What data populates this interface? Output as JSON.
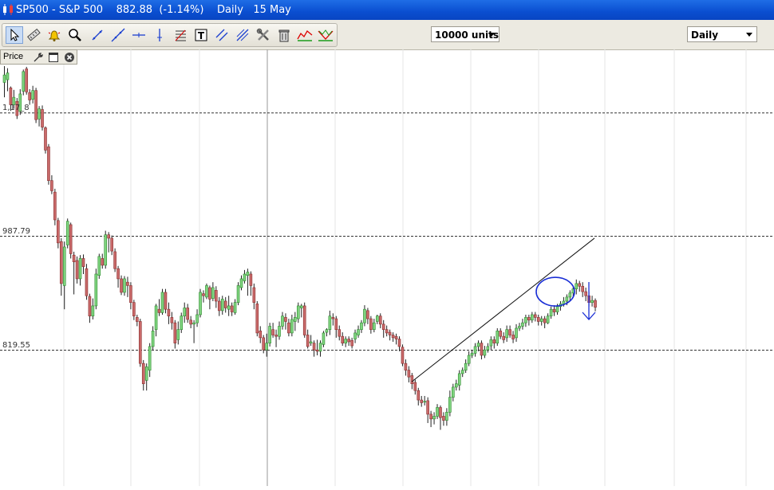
{
  "window": {
    "symbol": "SP500 - S&P 500",
    "price": "882.88",
    "change": "(-1.14%)",
    "timeframe": "Daily",
    "date": "15 May"
  },
  "toolbar": {
    "tools": [
      "pointer-tool",
      "ruler-tool",
      "alert-bell-tool",
      "zoom-tool",
      "trendline-tool",
      "ray-line-tool",
      "horizontal-line-tool",
      "vertical-line-tool",
      "fibonacci-tool",
      "text-tool",
      "parallel-channel-tool",
      "pitchfork-tool",
      "properties-tool",
      "delete-tool",
      "indicator-tool",
      "pattern-tool"
    ],
    "units_label": "10000 units",
    "period_label": "Daily"
  },
  "price_panel": {
    "tab_label": "Price"
  },
  "chart_data": {
    "type": "candlestick",
    "y_scale": {
      "top_value": 1252.0,
      "bottom_value": 619.0
    },
    "price_levels": [
      {
        "label": "1,17_8",
        "value": 1170.0
      },
      {
        "label": "987.79",
        "value": 987.79
      },
      {
        "label": "819.55",
        "value": 819.55
      }
    ],
    "annotation": {
      "trendline_from": 773,
      "trendline_to": 985,
      "circled_price": 906,
      "arrow": "down"
    },
    "candles": [
      [
        1215,
        1226,
        1193,
        1239
      ],
      [
        1219,
        1229,
        1202,
        1236
      ],
      [
        1207,
        1182,
        1173,
        1209
      ],
      [
        1182,
        1193,
        1176,
        1204
      ],
      [
        1187,
        1166,
        1161,
        1192
      ],
      [
        1172,
        1198,
        1167,
        1205
      ],
      [
        1202,
        1231,
        1196,
        1234
      ],
      [
        1235,
        1201,
        1197,
        1238
      ],
      [
        1200,
        1189,
        1182,
        1205
      ],
      [
        1190,
        1203,
        1184,
        1210
      ],
      [
        1203,
        1160,
        1155,
        1207
      ],
      [
        1161,
        1176,
        1150,
        1180
      ],
      [
        1175,
        1149,
        1144,
        1181
      ],
      [
        1148,
        1115,
        1110,
        1150
      ],
      [
        1120,
        1070,
        1064,
        1124
      ],
      [
        1070,
        1055,
        1050,
        1078
      ],
      [
        1053,
        1012,
        1004,
        1058
      ],
      [
        1011,
        978,
        970,
        1015
      ],
      [
        980,
        918,
        900,
        985
      ],
      [
        915,
        972,
        880,
        980
      ],
      [
        975,
        1010,
        970,
        1014
      ],
      [
        1005,
        962,
        955,
        1008
      ],
      [
        960,
        950,
        902,
        965
      ],
      [
        952,
        925,
        918,
        958
      ],
      [
        925,
        955,
        915,
        960
      ],
      [
        955,
        943,
        932,
        961
      ],
      [
        940,
        900,
        894,
        947
      ],
      [
        899,
        870,
        860,
        903
      ],
      [
        870,
        885,
        865,
        896
      ],
      [
        885,
        932,
        880,
        940
      ],
      [
        930,
        958,
        925,
        962
      ],
      [
        955,
        945,
        940,
        962
      ],
      [
        945,
        990,
        940,
        996
      ],
      [
        990,
        985,
        964,
        994
      ],
      [
        985,
        966,
        960,
        989
      ],
      [
        965,
        940,
        935,
        970
      ],
      [
        940,
        925,
        912,
        944
      ],
      [
        925,
        905,
        901,
        930
      ],
      [
        905,
        925,
        900,
        929
      ],
      [
        920,
        915,
        898,
        928
      ],
      [
        915,
        890,
        880,
        920
      ],
      [
        890,
        870,
        864,
        894
      ],
      [
        868,
        862,
        855,
        872
      ],
      [
        862,
        800,
        795,
        866
      ],
      [
        800,
        770,
        760,
        805
      ],
      [
        775,
        795,
        760,
        800
      ],
      [
        790,
        825,
        780,
        830
      ],
      [
        825,
        848,
        820,
        855
      ],
      [
        850,
        885,
        840,
        888
      ],
      [
        880,
        875,
        870,
        895
      ],
      [
        875,
        905,
        872,
        910
      ],
      [
        905,
        880,
        874,
        910
      ],
      [
        880,
        870,
        858,
        890
      ],
      [
        868,
        860,
        850,
        876
      ],
      [
        860,
        830,
        822,
        864
      ],
      [
        835,
        850,
        828,
        862
      ],
      [
        850,
        870,
        845,
        875
      ],
      [
        870,
        882,
        860,
        890
      ],
      [
        882,
        865,
        860,
        888
      ],
      [
        864,
        858,
        852,
        870
      ],
      [
        858,
        860,
        830,
        864
      ],
      [
        860,
        872,
        854,
        880
      ],
      [
        872,
        905,
        868,
        910
      ],
      [
        903,
        900,
        890,
        908
      ],
      [
        898,
        915,
        895,
        918
      ],
      [
        912,
        895,
        880,
        915
      ],
      [
        896,
        912,
        892,
        920
      ],
      [
        908,
        892,
        882,
        914
      ],
      [
        892,
        878,
        870,
        898
      ],
      [
        878,
        895,
        872,
        900
      ],
      [
        892,
        882,
        875,
        898
      ],
      [
        880,
        885,
        870,
        900
      ],
      [
        885,
        876,
        870,
        890
      ],
      [
        875,
        890,
        872,
        895
      ],
      [
        890,
        915,
        886,
        920
      ],
      [
        912,
        925,
        908,
        930
      ],
      [
        922,
        932,
        918,
        938
      ],
      [
        930,
        935,
        900,
        940
      ],
      [
        932,
        915,
        900,
        936
      ],
      [
        912,
        890,
        880,
        918
      ],
      [
        888,
        845,
        840,
        892
      ],
      [
        848,
        838,
        830,
        855
      ],
      [
        838,
        820,
        815,
        842
      ],
      [
        820,
        830,
        810,
        844
      ],
      [
        830,
        855,
        825,
        860
      ],
      [
        850,
        842,
        838,
        860
      ],
      [
        842,
        840,
        824,
        850
      ],
      [
        840,
        855,
        835,
        862
      ],
      [
        855,
        870,
        850,
        876
      ],
      [
        868,
        862,
        850,
        874
      ],
      [
        860,
        845,
        840,
        866
      ],
      [
        845,
        865,
        840,
        872
      ],
      [
        862,
        868,
        848,
        876
      ],
      [
        866,
        885,
        860,
        890
      ],
      [
        882,
        885,
        868,
        888
      ],
      [
        885,
        842,
        838,
        890
      ],
      [
        842,
        825,
        822,
        850
      ],
      [
        830,
        832,
        826,
        842
      ],
      [
        830,
        820,
        810,
        834
      ],
      [
        820,
        818,
        812,
        835
      ],
      [
        818,
        830,
        810,
        834
      ],
      [
        828,
        845,
        824,
        848
      ],
      [
        846,
        850,
        840,
        852
      ],
      [
        850,
        870,
        842,
        878
      ],
      [
        868,
        866,
        856,
        874
      ],
      [
        866,
        850,
        838,
        870
      ],
      [
        850,
        840,
        834,
        856
      ],
      [
        840,
        830,
        826,
        846
      ],
      [
        830,
        836,
        824,
        840
      ],
      [
        836,
        832,
        826,
        840
      ],
      [
        834,
        826,
        822,
        838
      ],
      [
        836,
        845,
        830,
        850
      ],
      [
        842,
        850,
        838,
        856
      ],
      [
        850,
        860,
        845,
        864
      ],
      [
        860,
        880,
        855,
        886
      ],
      [
        878,
        866,
        858,
        882
      ],
      [
        866,
        850,
        844,
        870
      ],
      [
        850,
        860,
        846,
        866
      ],
      [
        862,
        870,
        858,
        872
      ],
      [
        870,
        858,
        852,
        874
      ],
      [
        858,
        850,
        838,
        864
      ],
      [
        850,
        845,
        840,
        856
      ],
      [
        846,
        842,
        834,
        850
      ],
      [
        842,
        838,
        832,
        846
      ],
      [
        840,
        836,
        828,
        844
      ],
      [
        836,
        825,
        818,
        840
      ],
      [
        824,
        800,
        796,
        828
      ],
      [
        800,
        790,
        782,
        806
      ],
      [
        790,
        780,
        772,
        796
      ],
      [
        782,
        770,
        762,
        786
      ],
      [
        772,
        760,
        754,
        776
      ],
      [
        760,
        746,
        738,
        764
      ],
      [
        746,
        742,
        736,
        752
      ],
      [
        744,
        744,
        738,
        752
      ],
      [
        745,
        725,
        712,
        750
      ],
      [
        725,
        718,
        706,
        730
      ],
      [
        718,
        722,
        710,
        728
      ],
      [
        722,
        735,
        718,
        740
      ],
      [
        735,
        720,
        702,
        738
      ],
      [
        722,
        716,
        708,
        728
      ],
      [
        716,
        728,
        708,
        734
      ],
      [
        728,
        750,
        722,
        760
      ],
      [
        750,
        765,
        744,
        770
      ],
      [
        765,
        770,
        760,
        776
      ],
      [
        768,
        785,
        760,
        790
      ],
      [
        785,
        790,
        780,
        794
      ],
      [
        790,
        800,
        786,
        806
      ],
      [
        800,
        812,
        796,
        818
      ],
      [
        812,
        815,
        808,
        820
      ],
      [
        815,
        825,
        810,
        830
      ],
      [
        825,
        830,
        818,
        834
      ],
      [
        830,
        812,
        806,
        834
      ],
      [
        812,
        820,
        808,
        826
      ],
      [
        820,
        825,
        816,
        830
      ],
      [
        826,
        835,
        820,
        840
      ],
      [
        835,
        830,
        822,
        840
      ],
      [
        830,
        848,
        826,
        852
      ],
      [
        848,
        840,
        836,
        852
      ],
      [
        840,
        835,
        830,
        846
      ],
      [
        838,
        850,
        832,
        856
      ],
      [
        850,
        842,
        838,
        856
      ],
      [
        842,
        836,
        830,
        848
      ],
      [
        838,
        852,
        832,
        858
      ],
      [
        852,
        855,
        848,
        860
      ],
      [
        855,
        860,
        850,
        866
      ],
      [
        860,
        868,
        854,
        872
      ],
      [
        868,
        864,
        856,
        872
      ],
      [
        864,
        872,
        860,
        876
      ],
      [
        872,
        868,
        862,
        876
      ],
      [
        868,
        862,
        856,
        872
      ],
      [
        862,
        866,
        856,
        870
      ],
      [
        866,
        860,
        852,
        870
      ],
      [
        860,
        870,
        858,
        874
      ],
      [
        870,
        880,
        866,
        884
      ],
      [
        880,
        876,
        870,
        886
      ],
      [
        876,
        884,
        872,
        888
      ],
      [
        884,
        888,
        878,
        892
      ],
      [
        888,
        892,
        884,
        898
      ],
      [
        892,
        898,
        886,
        902
      ],
      [
        898,
        904,
        892,
        908
      ],
      [
        904,
        910,
        898,
        914
      ],
      [
        910,
        918,
        902,
        924
      ],
      [
        918,
        914,
        906,
        922
      ],
      [
        914,
        906,
        898,
        920
      ],
      [
        906,
        900,
        892,
        912
      ],
      [
        900,
        890,
        884,
        906
      ],
      [
        890,
        893,
        884,
        900
      ],
      [
        893,
        883,
        877,
        896
      ]
    ]
  }
}
